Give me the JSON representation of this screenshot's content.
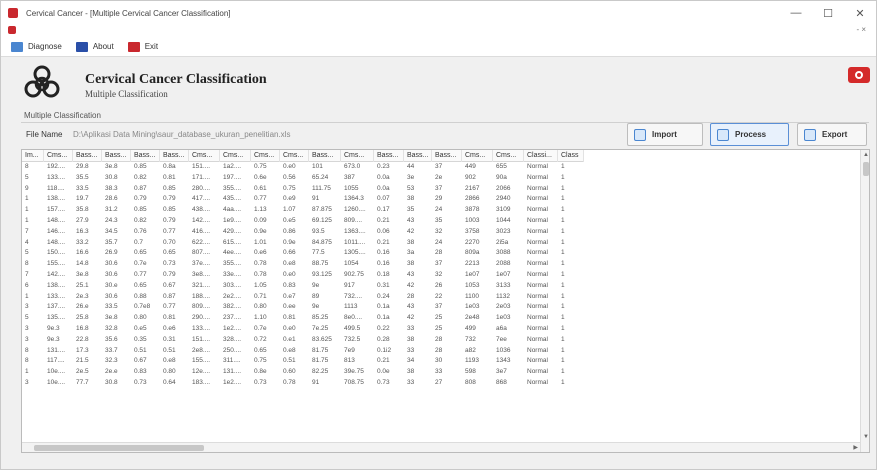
{
  "window": {
    "title": "Cervical Cancer - [Multiple Cervical Cancer Classification]",
    "controls": [
      "—",
      "☐",
      "✕"
    ]
  },
  "menubar_hint": {
    "controls": "- ×"
  },
  "menu": [
    {
      "label": "Diagnose",
      "color": "#4a86d0"
    },
    {
      "label": "About",
      "color": "#2a4fa8"
    },
    {
      "label": "Exit",
      "color": "#c9282e"
    }
  ],
  "header": {
    "title": "Cervical Cancer Classification",
    "subtitle": "Multiple Classification"
  },
  "section_label": "Multiple Classification",
  "file": {
    "label": "File Name",
    "path": "D:\\Aplikasi Data Mining\\saur_database_ukuran_penelitian.xls"
  },
  "buttons": {
    "import": "Import",
    "process": "Process",
    "export": "Export"
  },
  "table": {
    "columns": [
      "Im...",
      "Cms...",
      "Bass...",
      "Bass...",
      "Bass...",
      "Bass...",
      "Cms...",
      "Cms...",
      "Cms...",
      "Cms...",
      "Bass...",
      "Cms...",
      "Bass...",
      "Bass...",
      "Bass...",
      "Cms...",
      "Cms...",
      "Classi...",
      "Class"
    ],
    "rows": [
      [
        "8",
        "192....",
        "29.8",
        "3e.8",
        "0.85",
        "0.8a",
        "151....",
        "1a2....",
        "0.75",
        "0.e0",
        "101",
        "673.0",
        "0.23",
        "44",
        "37",
        "449",
        "655",
        "Normal",
        "1"
      ],
      [
        "5",
        "133....",
        "35.5",
        "30.8",
        "0.82",
        "0.81",
        "171....",
        "197....",
        "0.6e",
        "0.56",
        "65.24",
        "387",
        "0.0a",
        "3e",
        "2e",
        "902",
        "90a",
        "Normal",
        "1"
      ],
      [
        "9",
        "118....",
        "33.5",
        "38.3",
        "0.87",
        "0.85",
        "280....",
        "355....",
        "0.61",
        "0.75",
        "111.75",
        "1055",
        "0.0a",
        "53",
        "37",
        "2167",
        "2066",
        "Normal",
        "1"
      ],
      [
        "1",
        "138....",
        "19.7",
        "28.6",
        "0.79",
        "0.79",
        "417....",
        "435....",
        "0.77",
        "0.e9",
        "91",
        "1364.3",
        "0.07",
        "38",
        "29",
        "2866",
        "2940",
        "Normal",
        "1"
      ],
      [
        "1",
        "157....",
        "35.8",
        "31.2",
        "0.85",
        "0.85",
        "438....",
        "4aa....",
        "1.13",
        "1.07",
        "87.875",
        "1260....",
        "0.17",
        "35",
        "24",
        "3878",
        "3109",
        "Normal",
        "1"
      ],
      [
        "1",
        "148....",
        "27.9",
        "24.3",
        "0.82",
        "0.79",
        "142....",
        "1e9....",
        "0.09",
        "0.e5",
        "69.125",
        "809....",
        "0.21",
        "43",
        "35",
        "1003",
        "1044",
        "Normal",
        "1"
      ],
      [
        "7",
        "146....",
        "16.3",
        "34.5",
        "0.76",
        "0.77",
        "416....",
        "429....",
        "0.9e",
        "0.86",
        "93.5",
        "1363....",
        "0.06",
        "42",
        "32",
        "3758",
        "3023",
        "Normal",
        "1"
      ],
      [
        "4",
        "148....",
        "33.2",
        "35.7",
        "0.7",
        "0.70",
        "622....",
        "615....",
        "1.01",
        "0.9e",
        "84.875",
        "1011....",
        "0.21",
        "38",
        "24",
        "2270",
        "2i5a",
        "Normal",
        "1"
      ],
      [
        "5",
        "150....",
        "16.6",
        "26.9",
        "0.65",
        "0.65",
        "807....",
        "4ee....",
        "0.e6",
        "0.66",
        "77.5",
        "1305....",
        "0.16",
        "3a",
        "28",
        "809a",
        "3088",
        "Normal",
        "1"
      ],
      [
        "8",
        "155....",
        "14.8",
        "30.6",
        "0.7e",
        "0.73",
        "37e....",
        "355....",
        "0.78",
        "0.e8",
        "88.75",
        "1054",
        "0.16",
        "38",
        "37",
        "2213",
        "2088",
        "Normal",
        "1"
      ],
      [
        "7",
        "142....",
        "3e.8",
        "30.6",
        "0.77",
        "0.79",
        "3e8....",
        "33e....",
        "0.78",
        "0.e0",
        "93.125",
        "902.75",
        "0.18",
        "43",
        "32",
        "1e07",
        "1e07",
        "Normal",
        "1"
      ],
      [
        "6",
        "138....",
        "25.1",
        "30.e",
        "0.65",
        "0.67",
        "321....",
        "303....",
        "1.05",
        "0.83",
        "9e",
        "917",
        "0.31",
        "42",
        "26",
        "1053",
        "3133",
        "Normal",
        "1"
      ],
      [
        "1",
        "133....",
        "2e.3",
        "30.6",
        "0.88",
        "0.87",
        "188....",
        "2e2....",
        "0.71",
        "0.e7",
        "89",
        "732....",
        "0.24",
        "28",
        "22",
        "1100",
        "1132",
        "Normal",
        "1"
      ],
      [
        "3",
        "137....",
        "26.e",
        "33.5",
        "0.7e8",
        "0.77",
        "809....",
        "382....",
        "0.80",
        "0.ee",
        "9e",
        "1113",
        "0.1a",
        "43",
        "37",
        "1e03",
        "2e03",
        "Normal",
        "1"
      ],
      [
        "5",
        "135....",
        "25.8",
        "3e.8",
        "0.80",
        "0.81",
        "290....",
        "237....",
        "1.10",
        "0.81",
        "85.25",
        "8e0....",
        "0.1a",
        "42",
        "25",
        "2e48",
        "1e03",
        "Normal",
        "1"
      ],
      [
        "3",
        "9e.3",
        "16.8",
        "32.8",
        "0.e5",
        "0.e6",
        "133....",
        "1e2....",
        "0.7e",
        "0.e0",
        "7e.25",
        "499.5",
        "0.22",
        "33",
        "25",
        "499",
        "a6a",
        "Normal",
        "1"
      ],
      [
        "3",
        "9e.3",
        "22.8",
        "35.6",
        "0.35",
        "0.31",
        "151....",
        "328....",
        "0.72",
        "0.e1",
        "83.625",
        "732.5",
        "0.28",
        "38",
        "28",
        "732",
        "7ee",
        "Normal",
        "1"
      ],
      [
        "8",
        "131....",
        "17.3",
        "33.7",
        "0.51",
        "0.51",
        "2e8....",
        "250....",
        "0.65",
        "0.e8",
        "81.75",
        "7e9",
        "0.1i2",
        "33",
        "28",
        "a82",
        "1036",
        "Normal",
        "1"
      ],
      [
        "8",
        "117....",
        "21.5",
        "32.3",
        "0.67",
        "0.e8",
        "155....",
        "311....",
        "0.75",
        "0.51",
        "81.75",
        "813",
        "0.21",
        "34",
        "30",
        "1193",
        "1343",
        "Normal",
        "1"
      ],
      [
        "1",
        "10e....",
        "2e.5",
        "2e.e",
        "0.83",
        "0.80",
        "12e....",
        "131....",
        "0.8e",
        "0.60",
        "82.25",
        "39e.75",
        "0.0e",
        "38",
        "33",
        "598",
        "3e7",
        "Normal",
        "1"
      ],
      [
        "3",
        "10e....",
        "77.7",
        "30.8",
        "0.73",
        "0.64",
        "183....",
        "1e2....",
        "0.73",
        "0.78",
        "91",
        "708.75",
        "0.73",
        "33",
        "27",
        "808",
        "868",
        "Normal",
        "1"
      ]
    ]
  },
  "colors": {
    "accent": "#4a86d0",
    "danger": "#c9282e",
    "row_text": "#555555"
  }
}
